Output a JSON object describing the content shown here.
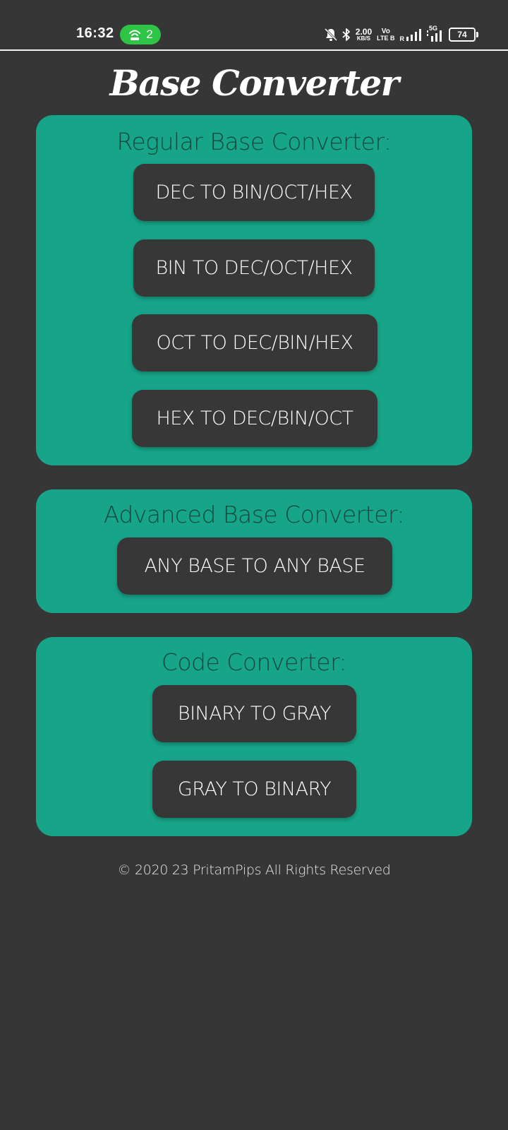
{
  "status_bar": {
    "time": "16:32",
    "hotspot_count": "2",
    "data_speed_value": "2.00",
    "data_speed_unit": "KB/S",
    "volte_top": "Vo",
    "volte_bottom": "LTE B",
    "roaming": "R",
    "network_type": "5G",
    "battery_level": "74",
    "icons": [
      "hotspot-icon",
      "mute-icon",
      "bluetooth-icon",
      "signal-icon",
      "battery-icon"
    ]
  },
  "app": {
    "title": "Base Converter"
  },
  "sections": {
    "regular": {
      "heading": "Regular Base Converter:",
      "buttons": [
        "DEC TO BIN/OCT/HEX",
        "BIN TO DEC/OCT/HEX",
        "OCT TO DEC/BIN/HEX",
        "HEX TO DEC/BIN/OCT"
      ]
    },
    "advanced": {
      "heading": "Advanced Base Converter:",
      "buttons": [
        "ANY BASE TO ANY BASE"
      ]
    },
    "code": {
      "heading": "Code Converter:",
      "buttons": [
        "BINARY TO GRAY",
        "GRAY TO BINARY"
      ]
    }
  },
  "footer": {
    "copyright": "© 2020 23 PritamPips All Rights Reserved"
  },
  "colors": {
    "background": "#363636",
    "card": "#17a589",
    "button": "#373737",
    "heading_text": "#11493c",
    "hotspot": "#2ec445"
  }
}
